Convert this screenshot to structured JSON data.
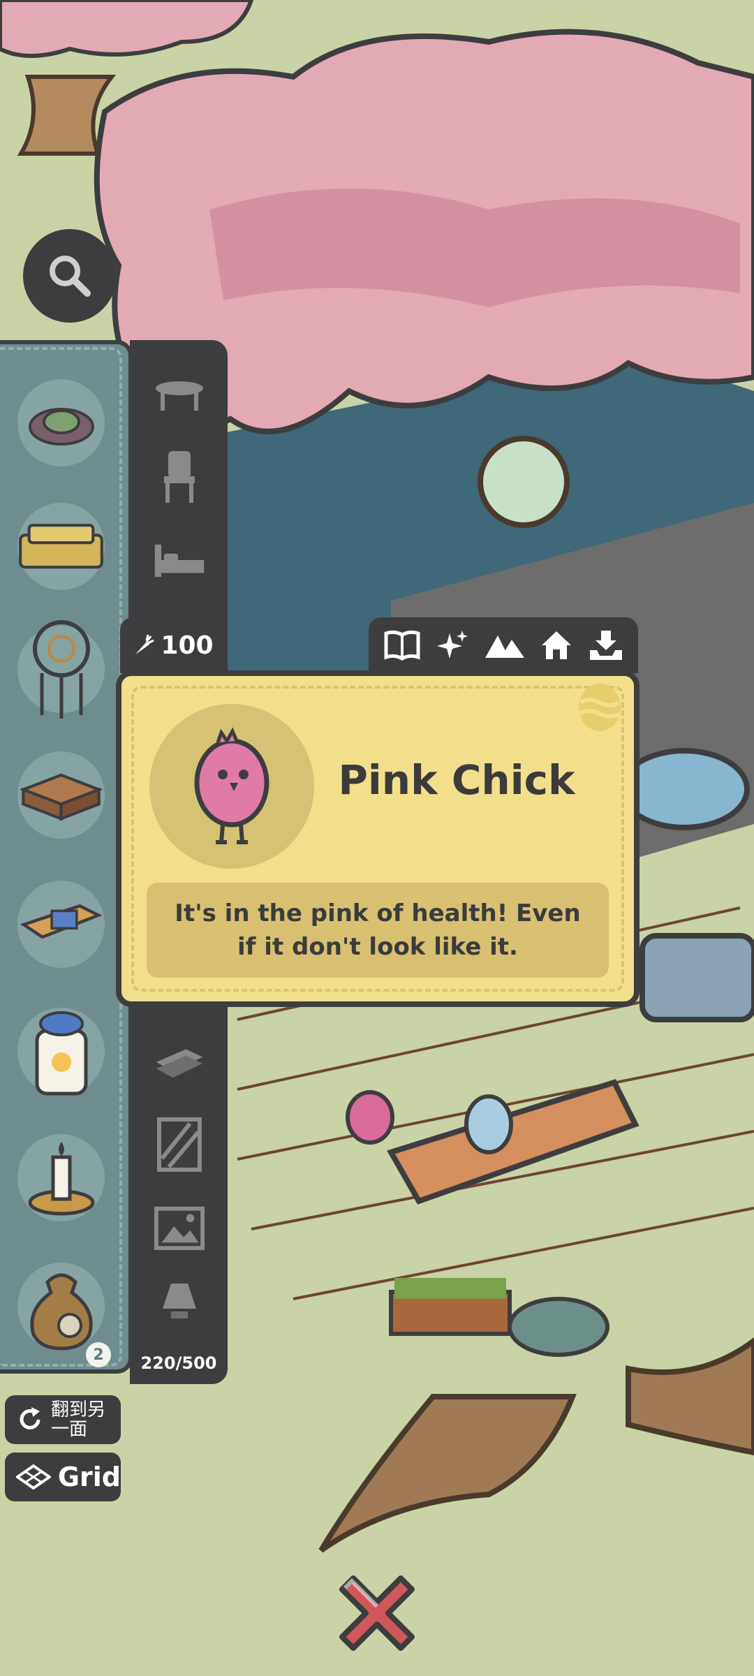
{
  "price": {
    "icon": "carrot-icon",
    "amount": "100"
  },
  "item_card": {
    "name": "Pink Chick",
    "description": "It's in the pink of health! Even if it don't look like it.",
    "portrait_icon": "pink-chick-icon"
  },
  "tool_tabs": [
    "book-icon",
    "sparkle-icon",
    "mountains-icon",
    "house-icon",
    "inbox-download-icon"
  ],
  "categories": [
    "table-icon",
    "chair-icon",
    "bed-icon",
    "rug-icon",
    "wallpaper-icon",
    "picture-frame-icon",
    "lamp-icon"
  ],
  "inventory": {
    "items": [
      "succulent",
      "sofa",
      "dreamcatcher",
      "low-table",
      "bench-with-cloth",
      "jar-lamp",
      "candle-holder",
      "sack"
    ],
    "badge_count": "2",
    "capacity": "220/500"
  },
  "buttons": {
    "flip_label": "翻到另一面",
    "grid_label": "Grid"
  },
  "colors": {
    "panel": "#6f8d8e",
    "dark_ui": "#3d3d3f",
    "card": "#f2df8c",
    "close_x": "#d0585b"
  }
}
